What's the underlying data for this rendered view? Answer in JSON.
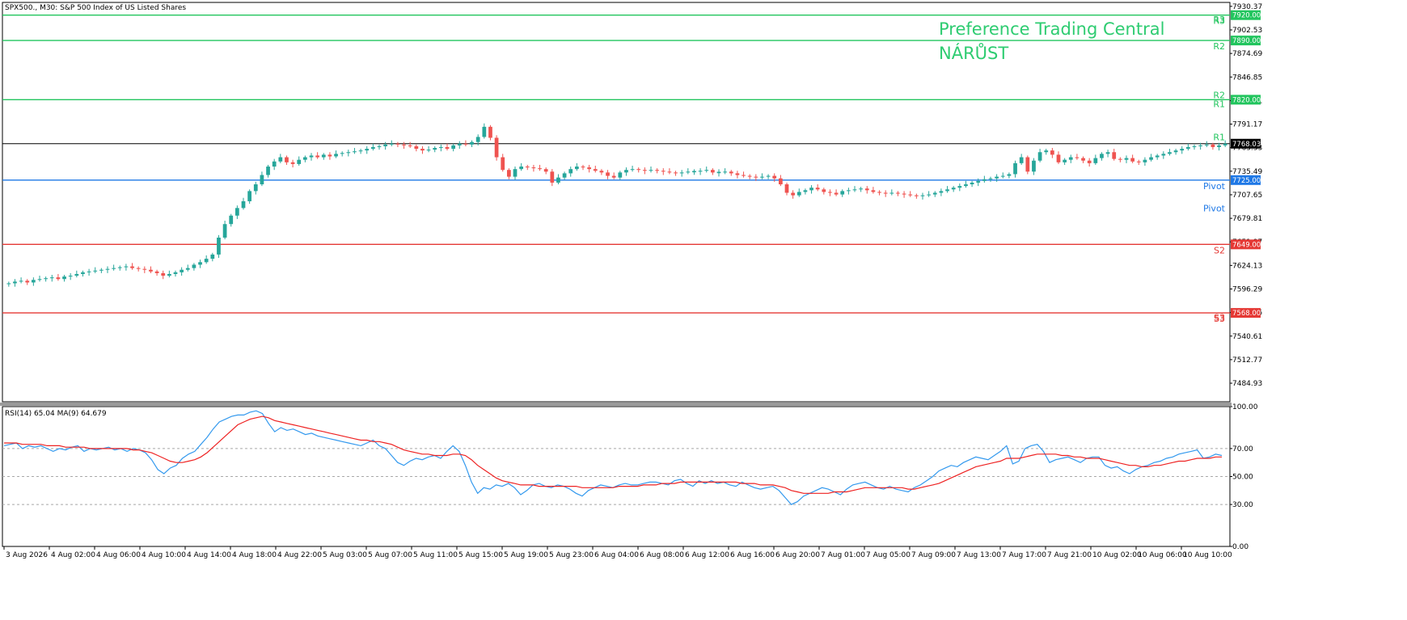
{
  "header": {
    "symbol_label": "SPX500., M30:  S&P 500 Index of US Listed Shares"
  },
  "watermark": {
    "title": "Preference Trading Central",
    "signal": "NÁRŮST"
  },
  "colors": {
    "up": "#26a69a",
    "down": "#ef5350",
    "resistance": "#22c55e",
    "pivot": "#1e78e6",
    "support": "#e53935",
    "current": "#000000",
    "rsi_line": "#3399ee",
    "rsi_ma": "#ee2222",
    "watermark": "#2ecc71",
    "grid": "#d9d9d9"
  },
  "chart_data": [
    {
      "type": "candlestick",
      "symbol": "SPX500.",
      "timeframe": "M30",
      "title": "S&P 500 Index of US Listed Shares",
      "ylim": [
        7463,
        7935
      ],
      "y_ticks": [
        "7930.37",
        "7902.53",
        "7874.69",
        "7846.85",
        "7819.01",
        "7791.17",
        "7763.33",
        "7735.49",
        "7707.65",
        "7679.81",
        "7651.97",
        "7624.13",
        "7596.29",
        "7568.45",
        "7540.61",
        "7512.77",
        "7484.93"
      ],
      "x_ticks": [
        "3 Aug 2026",
        "4 Aug 02:00",
        "4 Aug 06:00",
        "4 Aug 10:00",
        "4 Aug 14:00",
        "4 Aug 18:00",
        "4 Aug 22:00",
        "5 Aug 03:00",
        "5 Aug 07:00",
        "5 Aug 11:00",
        "5 Aug 15:00",
        "5 Aug 19:00",
        "5 Aug 23:00",
        "6 Aug 04:00",
        "6 Aug 08:00",
        "6 Aug 12:00",
        "6 Aug 16:00",
        "6 Aug 20:00",
        "7 Aug 01:00",
        "7 Aug 05:00",
        "7 Aug 09:00",
        "7 Aug 13:00",
        "7 Aug 17:00",
        "7 Aug 21:00",
        "10 Aug 02:00",
        "10 Aug 06:00",
        "10 Aug 10:00"
      ],
      "current_price": "7768.03",
      "levels": [
        {
          "name": "R3",
          "value": 7920.0,
          "label": "7920.00",
          "kind": "resistance"
        },
        {
          "name": "R2",
          "value": 7890.0,
          "label": "7890.00",
          "kind": "resistance"
        },
        {
          "name": "R2",
          "value": 7820.0,
          "label": "7820.00",
          "kind": "resistance",
          "tag_above": true
        },
        {
          "name": "Pivot",
          "value": 7725.0,
          "label": "7725.00",
          "kind": "pivot"
        },
        {
          "name": "S2",
          "value": 7649.0,
          "label": "7649.00",
          "kind": "support"
        },
        {
          "name": "S3",
          "value": 7568.0,
          "label": "7568.00",
          "kind": "support"
        }
      ],
      "extra_tags": [
        {
          "text": "R3",
          "value": 7915,
          "kind": "resistance"
        },
        {
          "text": "R1",
          "value": 7815,
          "kind": "resistance"
        },
        {
          "text": "R1",
          "value": 7776,
          "kind": "resistance"
        },
        {
          "text": "Pivot",
          "value": 7692,
          "kind": "pivot"
        },
        {
          "text": "S3",
          "value": 7563,
          "kind": "support"
        }
      ],
      "closes": [
        7603,
        7605,
        7606,
        7604,
        7607,
        7608,
        7609,
        7610,
        7608,
        7611,
        7612,
        7614,
        7616,
        7617,
        7618,
        7619,
        7620,
        7621,
        7622,
        7623,
        7621,
        7620,
        7619,
        7617,
        7615,
        7612,
        7614,
        7616,
        7619,
        7621,
        7625,
        7628,
        7632,
        7637,
        7657,
        7673,
        7683,
        7692,
        7700,
        7712,
        7720,
        7731,
        7741,
        7747,
        7752,
        7746,
        7744,
        7749,
        7752,
        7754,
        7752,
        7755,
        7753,
        7756,
        7757,
        7758,
        7759,
        7760,
        7762,
        7764,
        7765,
        7767,
        7768,
        7767,
        7766,
        7765,
        7762,
        7760,
        7761,
        7763,
        7764,
        7762,
        7766,
        7768,
        7767,
        7770,
        7776,
        7788,
        7775,
        7752,
        7737,
        7729,
        7738,
        7741,
        7740,
        7739,
        7738,
        7735,
        7722,
        7728,
        7733,
        7738,
        7741,
        7740,
        7738,
        7736,
        7734,
        7730,
        7728,
        7734,
        7737,
        7738,
        7737,
        7736,
        7737,
        7736,
        7735,
        7734,
        7733,
        7734,
        7735,
        7735,
        7736,
        7737,
        7734,
        7734,
        7735,
        7733,
        7731,
        7730,
        7729,
        7728,
        7729,
        7730,
        7727,
        7720,
        7710,
        7707,
        7711,
        7713,
        7716,
        7714,
        7711,
        7710,
        7708,
        7712,
        7713,
        7714,
        7715,
        7713,
        7711,
        7710,
        7709,
        7710,
        7709,
        7708,
        7707,
        7706,
        7707,
        7708,
        7710,
        7712,
        7714,
        7716,
        7718,
        7720,
        7722,
        7724,
        7726,
        7727,
        7729,
        7730,
        7732,
        7745,
        7752,
        7735,
        7748,
        7758,
        7760,
        7755,
        7746,
        7749,
        7752,
        7751,
        7748,
        7745,
        7751,
        7756,
        7758,
        7750,
        7749,
        7751,
        7747,
        7746,
        7749,
        7752,
        7754,
        7756,
        7758,
        7760,
        7762,
        7764,
        7765,
        7766,
        7767,
        7764,
        7766,
        7768
      ]
    },
    {
      "type": "line",
      "title": "RSI(14) 65.04 MA(9) 64.679",
      "ylim": [
        0,
        100
      ],
      "y_ticks": [
        "100.00",
        "70.00",
        "50.00",
        "30.00",
        "0.00"
      ],
      "levels": [
        70,
        50,
        30
      ],
      "series": [
        {
          "name": "RSI(14)",
          "values": [
            72,
            73,
            74,
            70,
            72,
            71,
            72,
            70,
            68,
            70,
            69,
            71,
            72,
            68,
            70,
            69,
            70,
            71,
            69,
            70,
            68,
            70,
            69,
            67,
            62,
            55,
            52,
            56,
            58,
            63,
            66,
            68,
            73,
            78,
            84,
            89,
            91,
            93,
            94,
            94,
            96,
            97,
            95,
            88,
            82,
            85,
            83,
            84,
            82,
            80,
            81,
            79,
            78,
            77,
            76,
            75,
            74,
            73,
            72,
            74,
            76,
            72,
            70,
            65,
            60,
            58,
            61,
            63,
            62,
            64,
            65,
            63,
            68,
            72,
            68,
            58,
            46,
            38,
            42,
            41,
            44,
            43,
            45,
            42,
            37,
            40,
            44,
            45,
            43,
            42,
            44,
            43,
            41,
            38,
            36,
            40,
            42,
            44,
            43,
            42,
            44,
            45,
            44,
            44,
            45,
            46,
            46,
            45,
            44,
            47,
            48,
            45,
            43,
            47,
            45,
            47,
            45,
            46,
            44,
            43,
            46,
            44,
            42,
            41,
            42,
            43,
            40,
            35,
            30,
            32,
            36,
            38,
            40,
            42,
            41,
            39,
            37,
            41,
            44,
            45,
            46,
            44,
            42,
            41,
            43,
            41,
            40,
            39,
            42,
            44,
            47,
            50,
            54,
            56,
            58,
            57,
            60,
            62,
            64,
            63,
            62,
            65,
            68,
            72,
            59,
            61,
            70,
            72,
            73,
            68,
            60,
            62,
            63,
            64,
            62,
            60,
            63,
            64,
            64,
            58,
            56,
            57,
            54,
            52,
            55,
            57,
            58,
            60,
            61,
            63,
            64,
            66,
            67,
            68,
            69,
            63,
            64,
            66,
            65
          ]
        },
        {
          "name": "MA(9)",
          "values": [
            74,
            74,
            74,
            73,
            73,
            73,
            73,
            72,
            72,
            72,
            71,
            71,
            71,
            71,
            70,
            70,
            70,
            70,
            70,
            70,
            70,
            69,
            69,
            68,
            67,
            65,
            63,
            61,
            60,
            60,
            61,
            62,
            64,
            67,
            71,
            75,
            79,
            83,
            87,
            89,
            91,
            92,
            93,
            92,
            90,
            89,
            88,
            87,
            86,
            85,
            84,
            83,
            82,
            81,
            80,
            79,
            78,
            77,
            76,
            76,
            75,
            75,
            74,
            73,
            71,
            69,
            68,
            67,
            66,
            66,
            65,
            65,
            65,
            66,
            66,
            65,
            62,
            58,
            55,
            52,
            49,
            47,
            46,
            45,
            44,
            44,
            44,
            43,
            43,
            43,
            43,
            43,
            43,
            43,
            42,
            42,
            42,
            42,
            42,
            42,
            43,
            43,
            43,
            43,
            44,
            44,
            44,
            45,
            45,
            45,
            46,
            46,
            46,
            46,
            46,
            46,
            46,
            46,
            46,
            46,
            45,
            45,
            45,
            44,
            44,
            44,
            43,
            42,
            40,
            39,
            38,
            38,
            38,
            38,
            38,
            39,
            39,
            39,
            40,
            41,
            42,
            42,
            42,
            42,
            42,
            42,
            42,
            41,
            41,
            42,
            43,
            44,
            45,
            47,
            49,
            51,
            53,
            55,
            57,
            58,
            59,
            60,
            61,
            63,
            63,
            63,
            64,
            65,
            66,
            66,
            66,
            66,
            65,
            65,
            64,
            64,
            63,
            63,
            63,
            62,
            61,
            60,
            59,
            58,
            58,
            57,
            57,
            58,
            58,
            59,
            60,
            61,
            61,
            62,
            63,
            63,
            63,
            64,
            64
          ]
        }
      ]
    }
  ]
}
